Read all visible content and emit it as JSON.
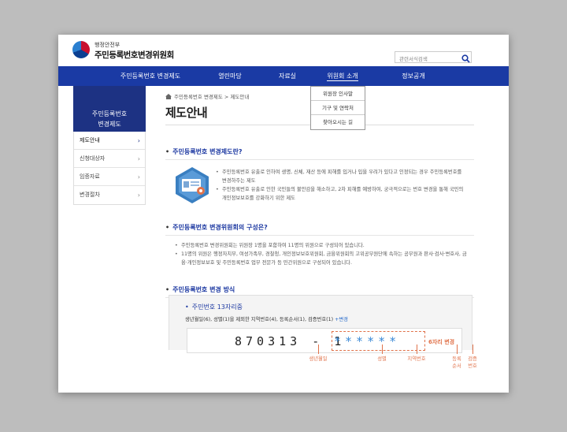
{
  "header": {
    "agency": "행정안전부",
    "site_title": "주민등록번호변경위원회",
    "search_placeholder": "관련서식검색"
  },
  "nav": {
    "items": [
      "주민등록번호 변경제도",
      "열린마당",
      "자료실",
      "위원회 소개",
      "정보공개"
    ],
    "active_index": 3
  },
  "dropdown": {
    "items": [
      "위원장 인사말",
      "기구 및 연락처",
      "찾아오시는 길"
    ]
  },
  "sidebar": {
    "heading": [
      "주민등록번호",
      "변경제도"
    ],
    "items": [
      "제도안내",
      "신청대상자",
      "임증자료",
      "변경절차"
    ],
    "active_index": 0
  },
  "breadcrumb": "주민등록번호 변경제도 > 제도안내",
  "page_title": "제도안내",
  "section1": {
    "title": "주민등록번호 변경제도란?",
    "bullets": [
      "주민등록번호 유출로 인하여 생명, 신체, 재산 등에 피해를 입거나 입을 우려가 있다고 인정되는 경우 주민등록번호를 변경하주는 제도",
      "주민등록번호 유출로 인한 국민들의 불안감을 해소하고, 2차 피해를 예방하여, 궁극적으로는 번호 변경을 통해 국민의 개인정보보호를 강화하기 위한 제도"
    ]
  },
  "section2": {
    "title": "주민등록번호 변경위원회의 구성은?",
    "bullets": [
      "주민등록번호 변경위원회는 위원장 1명을 포함하여 11명의 위원으로 구성되어 있습니다.",
      "11명의 위원은 행정자치부, 여성가족부, 경찰청, 개인정보보호위원회, 금융위원회의 고위공무원단에 속하는 공무원과 판사·검사·변호사, 금융·개인정보보호 및 주민등록번호 업무 전문가 등 민간위원으로 구성되어 있습니다."
    ]
  },
  "section3": {
    "title": "주민등록번호 변경 방식"
  },
  "rrn": {
    "title": "주민번호 13자리중",
    "desc": "생년월일(6), 성별(1)을 제외한 지역번호(4), 등록순서(1), 검증번호(1)",
    "desc_change": "+변경",
    "number": "870313 - 1",
    "stars": "******",
    "six_label": "6자리 변경",
    "tags": [
      "생년월일",
      "성별",
      "지역번호",
      "등록\n순서",
      "검증\n번호"
    ]
  },
  "colors": {
    "nav": "#1a3aa4",
    "sidebar_head": "#1d3283",
    "accent_orange": "#e0724a",
    "accent_blue": "#3a89d6"
  }
}
